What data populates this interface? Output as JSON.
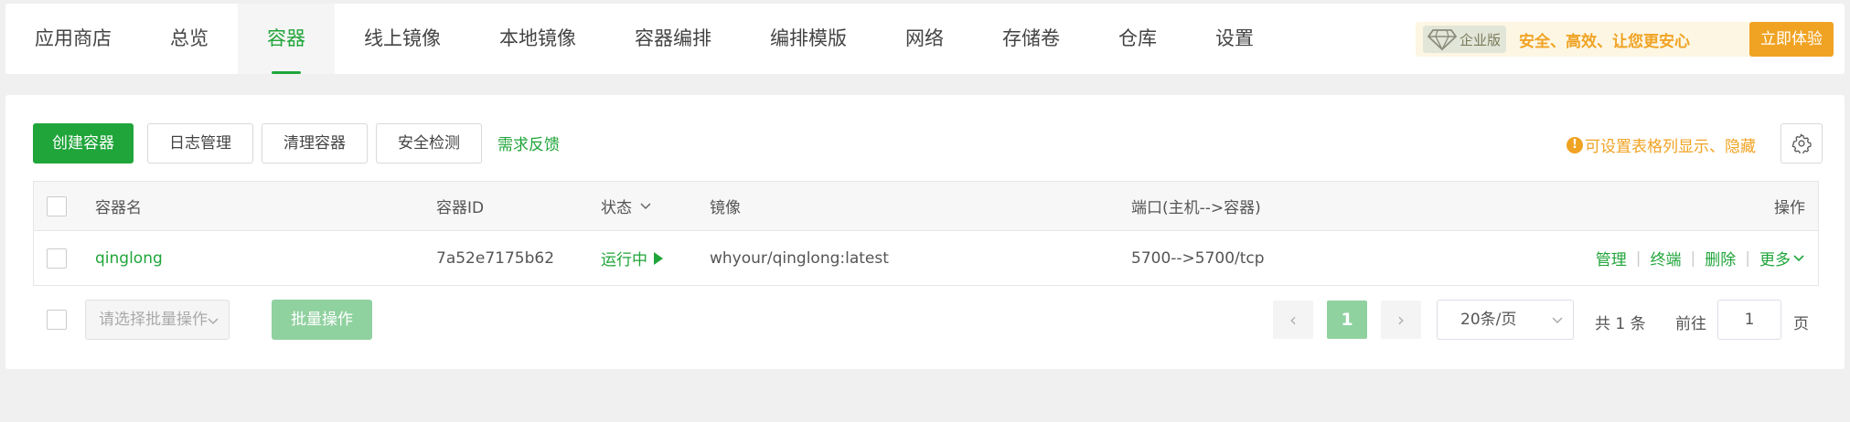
{
  "nav": {
    "tabs": [
      {
        "label": "应用商店"
      },
      {
        "label": "总览"
      },
      {
        "label": "容器"
      },
      {
        "label": "线上镜像"
      },
      {
        "label": "本地镜像"
      },
      {
        "label": "容器编排"
      },
      {
        "label": "编排模版"
      },
      {
        "label": "网络"
      },
      {
        "label": "存储卷"
      },
      {
        "label": "仓库"
      },
      {
        "label": "设置"
      }
    ],
    "active_tab": "容器",
    "promo": {
      "badge": "企业版",
      "text": "安全、高效、让您更安心",
      "button": "立即体验"
    }
  },
  "toolbar": {
    "create": "创建容器",
    "logs": "日志管理",
    "clean": "清理容器",
    "security": "安全检测",
    "feedback": "需求反馈",
    "tip": "可设置表格列显示、隐藏"
  },
  "table": {
    "headers": {
      "name": "容器名",
      "id": "容器ID",
      "status": "状态",
      "image": "镜像",
      "ports": "端口(主机-->容器)",
      "actions": "操作"
    },
    "rows": [
      {
        "name": "qinglong",
        "id": "7a52e7175b62",
        "status": "运行中",
        "image": "whyour/qinglong:latest",
        "ports": "5700-->5700/tcp",
        "actions": {
          "manage": "管理",
          "terminal": "终端",
          "delete": "删除",
          "more": "更多"
        }
      }
    ]
  },
  "footer": {
    "batch_placeholder": "请选择批量操作",
    "batch_button": "批量操作",
    "current_page": "1",
    "page_size": "20条/页",
    "total": "共 1 条",
    "goto_label": "前往",
    "goto_value": "1",
    "goto_unit": "页"
  },
  "colors": {
    "accent": "#20a53a",
    "warning": "#f0a323"
  }
}
